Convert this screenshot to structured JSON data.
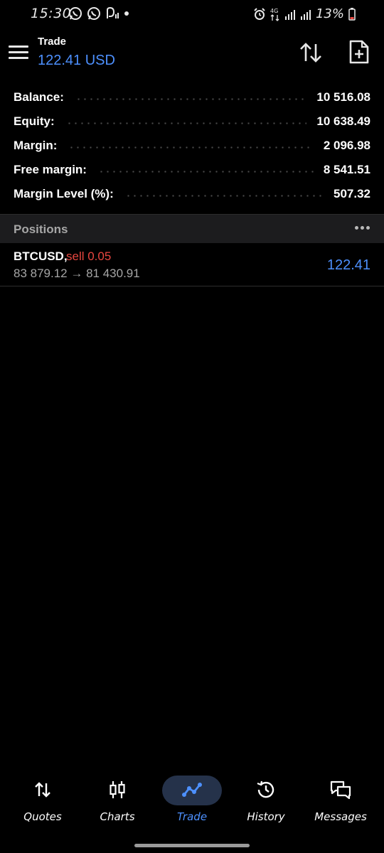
{
  "status_bar": {
    "time": "15:30",
    "battery": "13%",
    "network": "4G"
  },
  "toolbar": {
    "title": "Trade",
    "subtitle": "122.41 USD"
  },
  "summary": [
    {
      "label": "Balance:",
      "value": "10 516.08"
    },
    {
      "label": "Equity:",
      "value": "10 638.49"
    },
    {
      "label": "Margin:",
      "value": "2 096.98"
    },
    {
      "label": "Free margin:",
      "value": "8 541.51"
    },
    {
      "label": "Margin Level (%):",
      "value": "507.32"
    }
  ],
  "positions": {
    "title": "Positions",
    "items": [
      {
        "symbol": "BTCUSD,",
        "side": "sell 0.05",
        "prices": "83 879.12 → 81 430.91",
        "profit": "122.41"
      }
    ]
  },
  "nav": [
    {
      "label": "Quotes",
      "icon": "quotes-arrows-icon"
    },
    {
      "label": "Charts",
      "icon": "candlestick-icon"
    },
    {
      "label": "Trade",
      "icon": "trade-line-icon",
      "active": true
    },
    {
      "label": "History",
      "icon": "history-clock-icon"
    },
    {
      "label": "Messages",
      "icon": "chat-bubbles-icon"
    }
  ],
  "colors": {
    "accent": "#4d90fe",
    "sell": "#e8463f",
    "muted": "#a6a6a6",
    "background": "#000000",
    "section_bg": "#1c1c1e"
  }
}
